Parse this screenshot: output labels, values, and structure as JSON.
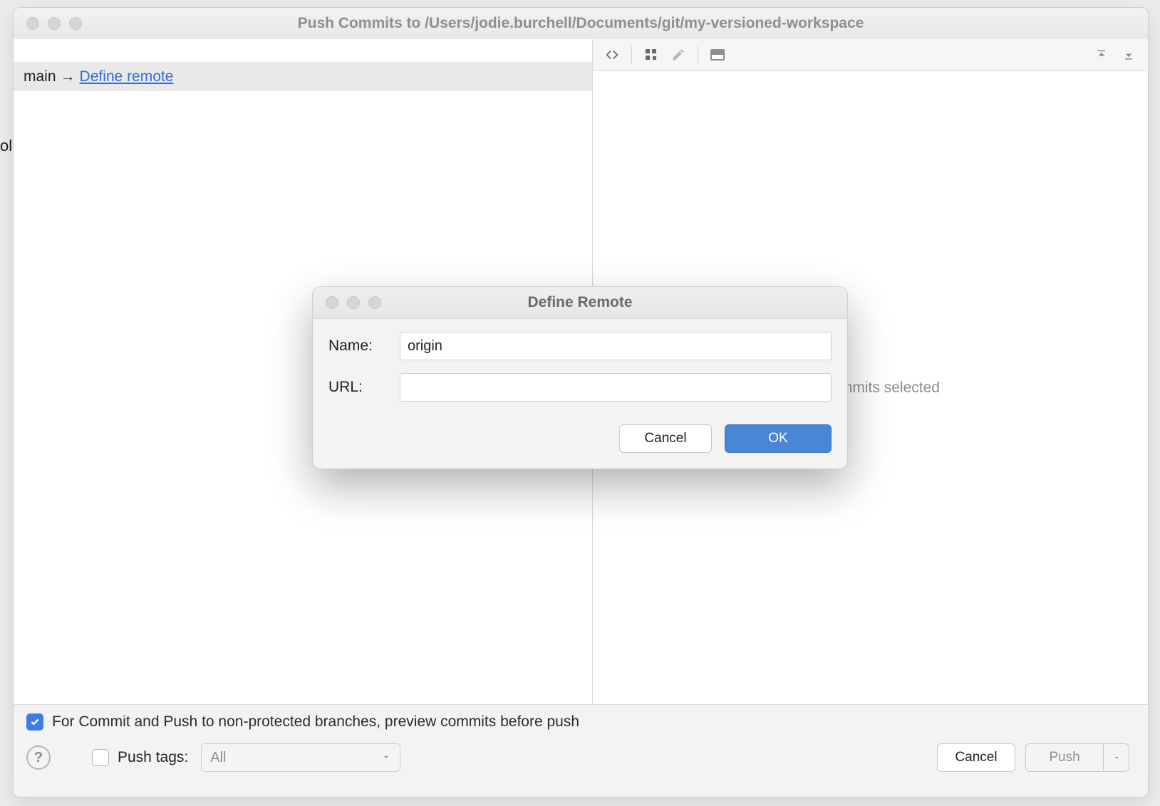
{
  "main": {
    "title": "Push Commits to /Users/jodie.burchell/Documents/git/my-versioned-workspace",
    "branch_row": {
      "branch": "main",
      "arrow": "→",
      "link": "Define remote"
    },
    "right_placeholder": "No commits selected",
    "bottom": {
      "preview_label": "For Commit and Push to non-protected branches, preview commits before push",
      "push_tags_label": "Push tags:",
      "push_tags_value": "All",
      "cancel": "Cancel",
      "push": "Push",
      "help": "?"
    }
  },
  "modal": {
    "title": "Define Remote",
    "name_label": "Name:",
    "name_value": "origin",
    "url_label": "URL:",
    "url_value": "",
    "cancel": "Cancel",
    "ok": "OK"
  },
  "edge_text": "ol"
}
